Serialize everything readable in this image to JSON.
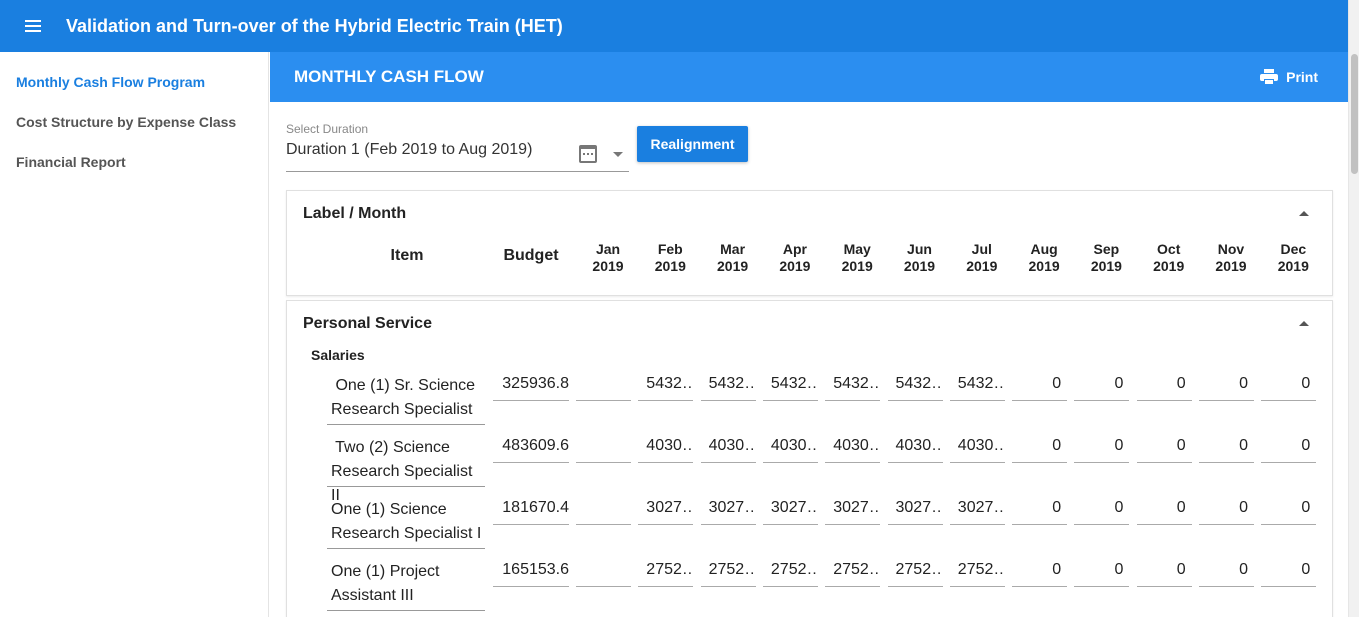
{
  "app": {
    "title": "Validation and Turn-over of the Hybrid Electric Train (HET)"
  },
  "sidebar": {
    "items": [
      {
        "label": "Monthly Cash Flow Program",
        "active": true
      },
      {
        "label": "Cost Structure by Expense Class",
        "active": false
      },
      {
        "label": "Financial Report",
        "active": false
      }
    ]
  },
  "subheader": {
    "title": "MONTHLY CASH FLOW",
    "print_label": "Print"
  },
  "duration": {
    "label": "Select Duration",
    "value": "Duration 1 (Feb 2019 to Aug 2019)"
  },
  "realign_label": "Realignment",
  "table_header": {
    "card_title": "Label / Month",
    "item_label": "Item",
    "budget_label": "Budget",
    "months": [
      {
        "m": "Jan",
        "y": "2019"
      },
      {
        "m": "Feb",
        "y": "2019"
      },
      {
        "m": "Mar",
        "y": "2019"
      },
      {
        "m": "Apr",
        "y": "2019"
      },
      {
        "m": "May",
        "y": "2019"
      },
      {
        "m": "Jun",
        "y": "2019"
      },
      {
        "m": "Jul",
        "y": "2019"
      },
      {
        "m": "Aug",
        "y": "2019"
      },
      {
        "m": "Sep",
        "y": "2019"
      },
      {
        "m": "Oct",
        "y": "2019"
      },
      {
        "m": "Nov",
        "y": "2019"
      },
      {
        "m": "Dec",
        "y": "2019"
      }
    ]
  },
  "section": {
    "title": "Personal Service",
    "group": "Salaries",
    "rows": [
      {
        "item_line1": " One (1) Sr. Science",
        "item_line2": "Research Specialist",
        "budget": "325936.8",
        "months": [
          "",
          "5432…",
          "5432…",
          "5432…",
          "5432…",
          "5432…",
          "5432…",
          "0",
          "0",
          "0",
          "0",
          "0"
        ]
      },
      {
        "item_line1": " Two (2) Science",
        "item_line2": "Research Specialist II",
        "budget": "483609.6",
        "months": [
          "",
          "4030…",
          "4030…",
          "4030…",
          "4030…",
          "4030…",
          "4030…",
          "0",
          "0",
          "0",
          "0",
          "0"
        ]
      },
      {
        "item_line1": "One (1) Science",
        "item_line2": "Research Specialist I",
        "budget": "181670.4",
        "months": [
          "",
          "3027…",
          "3027…",
          "3027…",
          "3027…",
          "3027…",
          "3027…",
          "0",
          "0",
          "0",
          "0",
          "0"
        ]
      },
      {
        "item_line1": "One (1) Project",
        "item_line2": "Assistant III",
        "budget": "165153.6",
        "months": [
          "",
          "2752…",
          "2752…",
          "2752…",
          "2752…",
          "2752…",
          "2752…",
          "0",
          "0",
          "0",
          "0",
          "0"
        ]
      }
    ]
  },
  "colors": {
    "topbar": "#1a7fe0",
    "subbar": "#2b8ef0",
    "accent": "#1a7fe0"
  }
}
